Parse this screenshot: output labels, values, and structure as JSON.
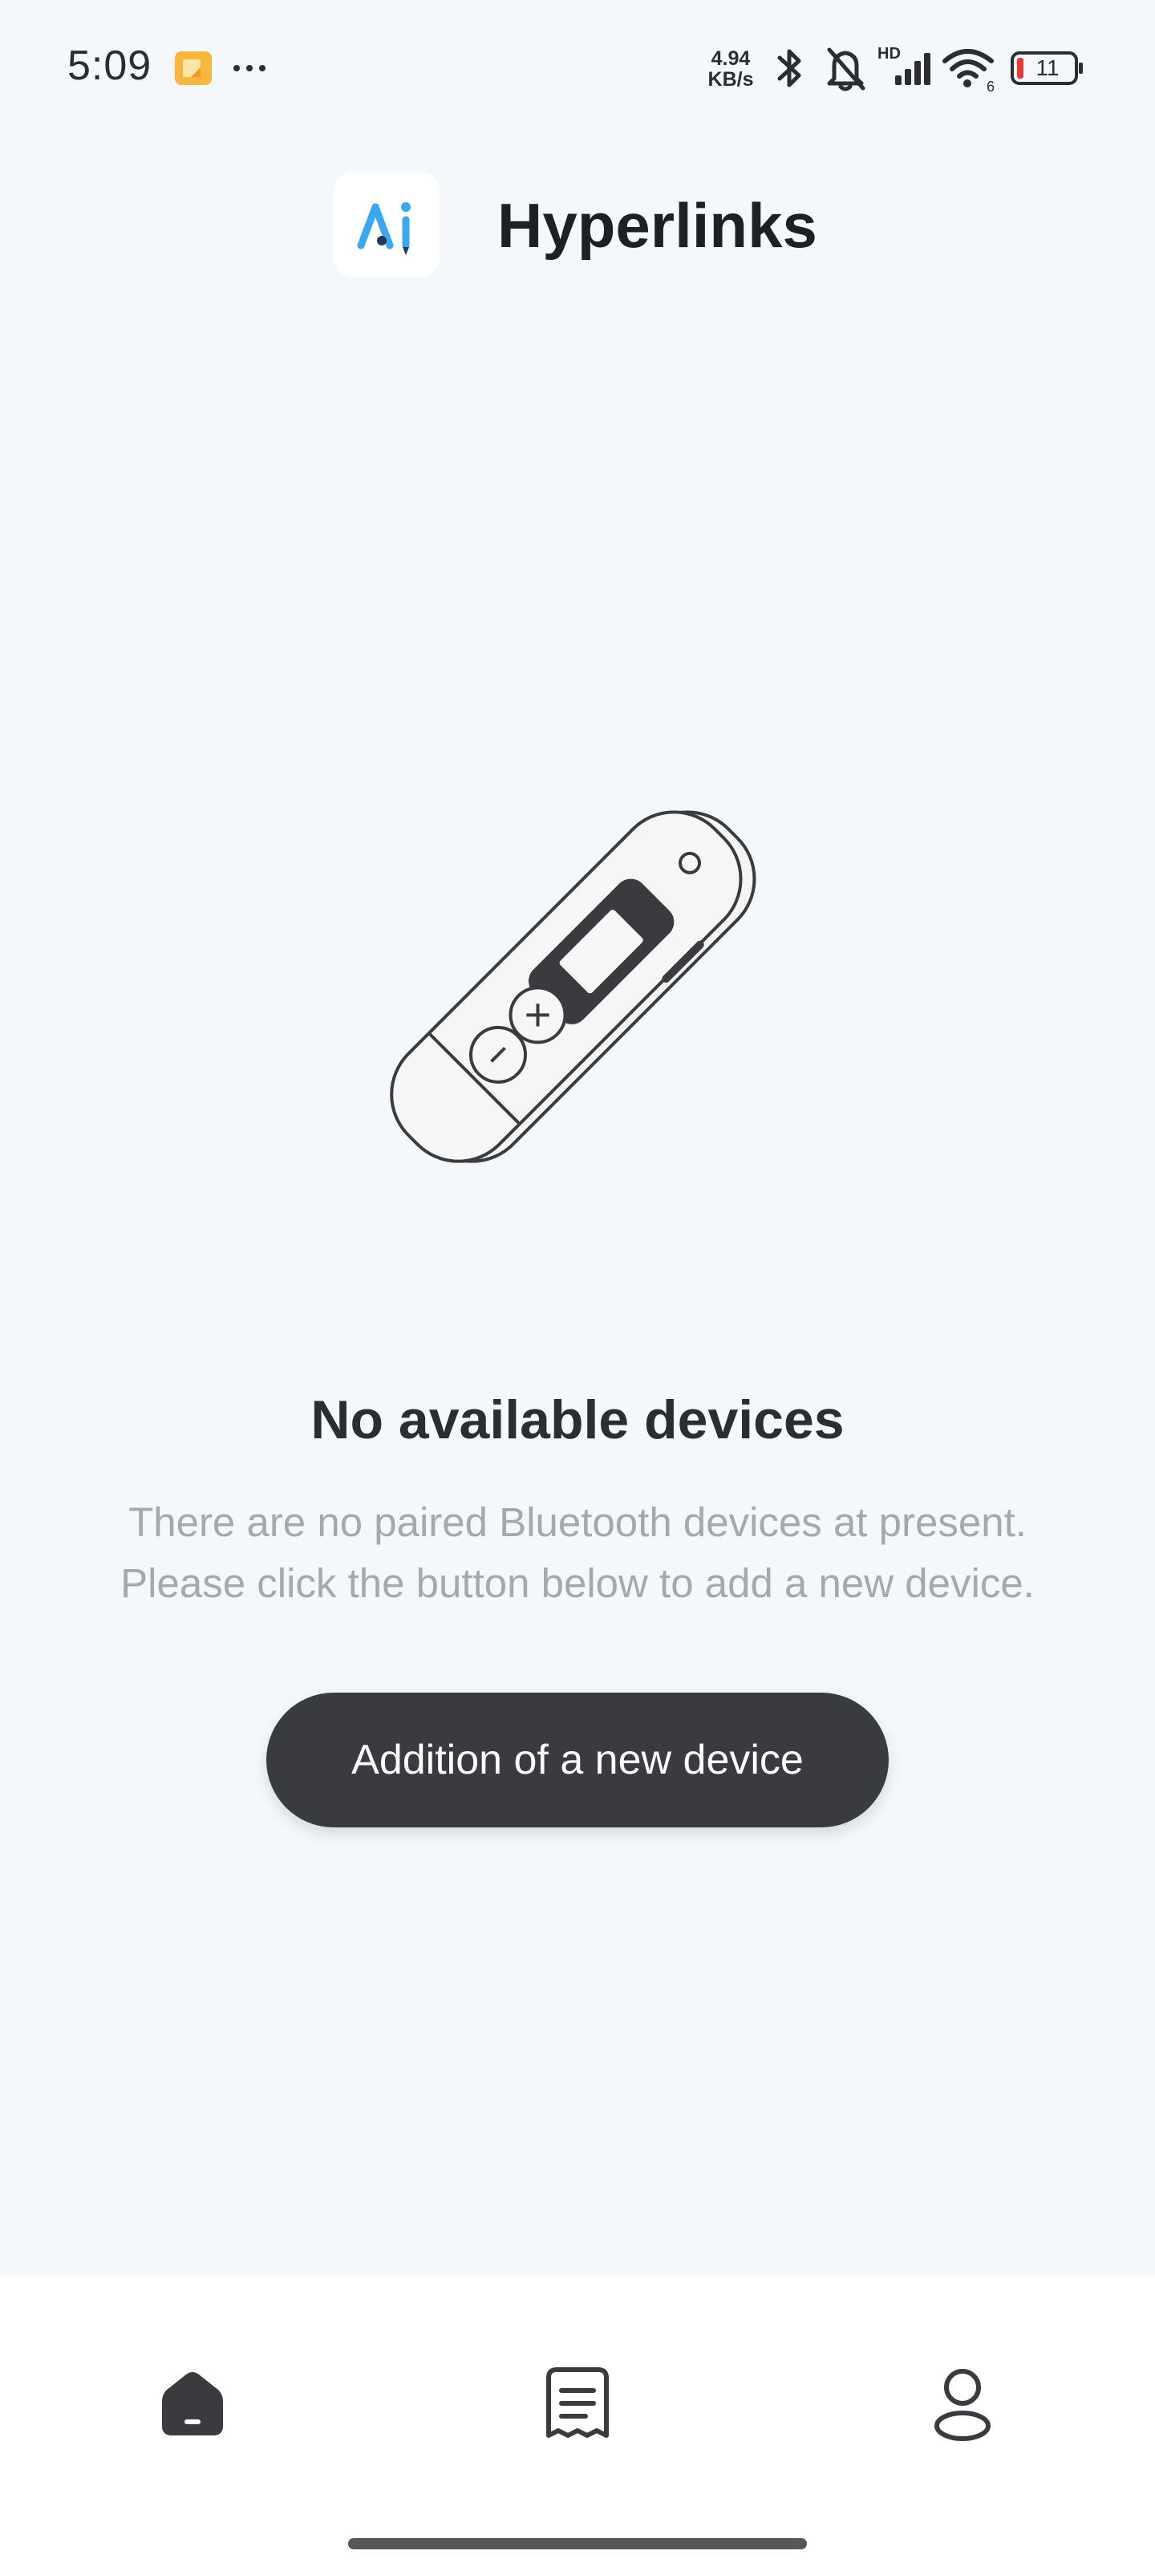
{
  "status_bar": {
    "time": "5:09",
    "net_speed_value": "4.94",
    "net_speed_unit": "KB/s",
    "network_label": "HD",
    "battery_level": "11",
    "icons": [
      "notification-icon",
      "more-icon",
      "bluetooth-icon",
      "mute-bell-icon",
      "cell-signal-icon",
      "wifi-icon",
      "battery-icon"
    ]
  },
  "header": {
    "logo_text": "Ai",
    "title": "Hyperlinks"
  },
  "empty_state": {
    "title": "No available devices",
    "description_line1": "There are no paired Bluetooth devices at present.",
    "description_line2": "Please click the button below to add a new device.",
    "button_label": "Addition of a new device"
  },
  "bottom_nav": {
    "items": [
      {
        "icon": "home-icon",
        "active": true
      },
      {
        "icon": "records-icon",
        "active": false
      },
      {
        "icon": "profile-icon",
        "active": false
      }
    ]
  },
  "colors": {
    "background": "#f4f8fb",
    "button": "#3a3b3f",
    "logo_accent": "#3aa7f0",
    "description_text": "#a5a8ad"
  }
}
